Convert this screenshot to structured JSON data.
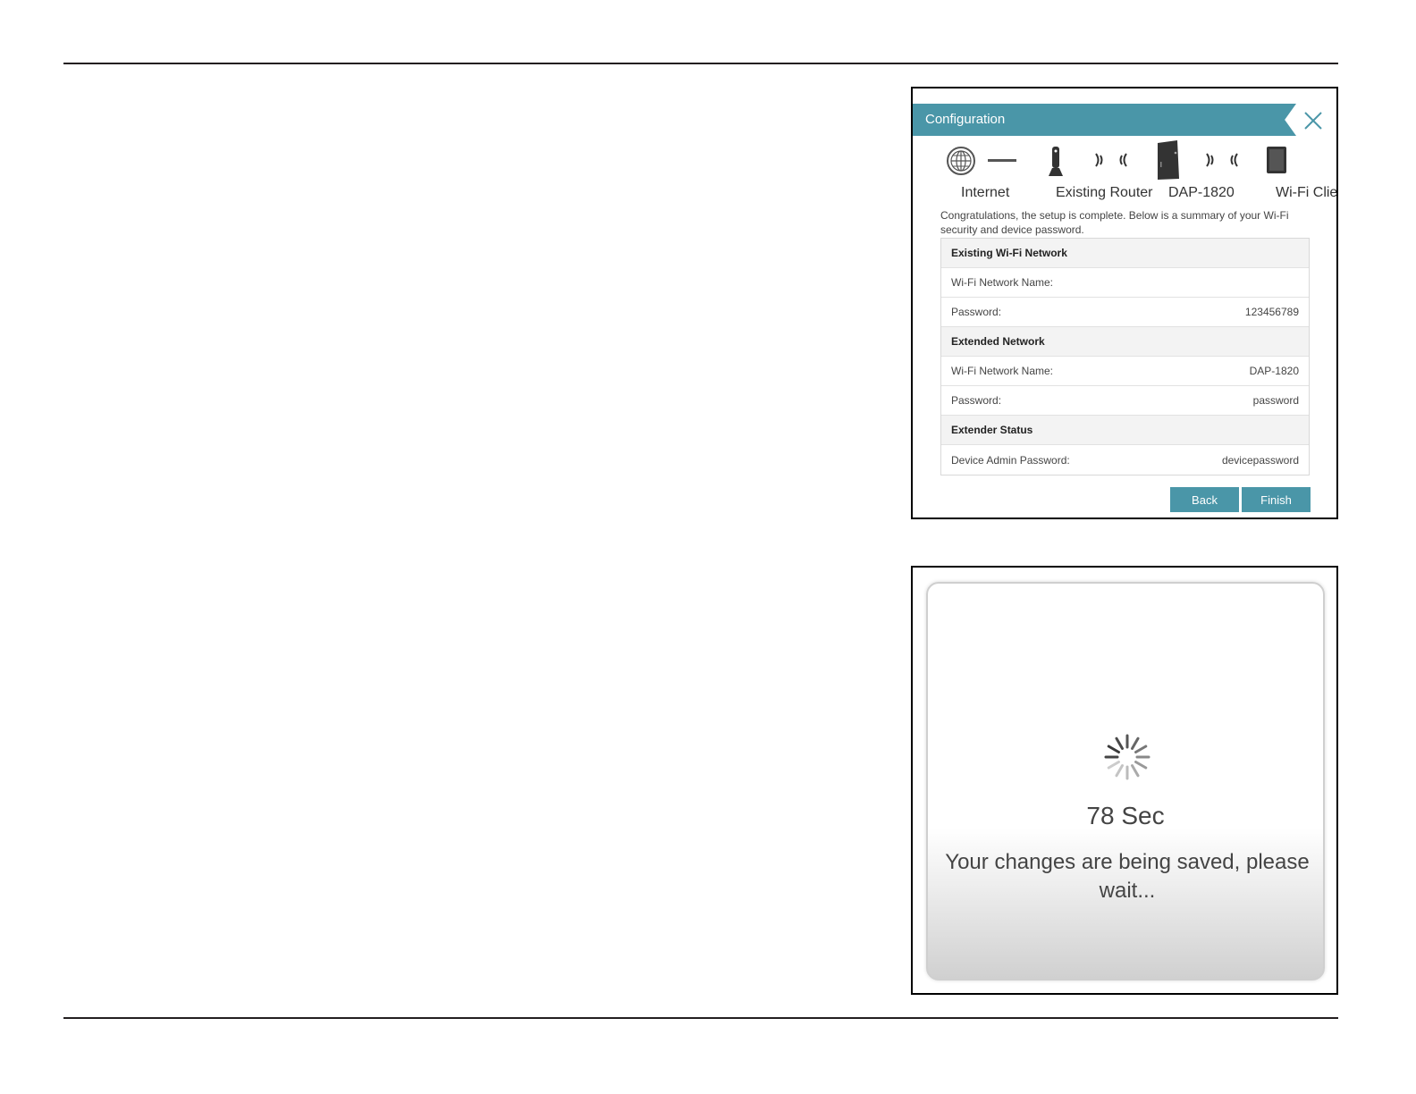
{
  "configuration": {
    "title": "Configuration",
    "topology": {
      "internet_label": "Internet",
      "router_label": "Existing Router",
      "extender_label": "DAP-1820",
      "client_label": "Wi-Fi Client"
    },
    "intro_text": "Congratulations, the setup is complete. Below is a summary of your Wi-Fi security and device password.",
    "sections": [
      {
        "heading": "Existing Wi-Fi Network",
        "rows": [
          {
            "label": "Wi-Fi Network Name:",
            "value": ""
          },
          {
            "label": "Password:",
            "value": "123456789"
          }
        ]
      },
      {
        "heading": "Extended Network",
        "rows": [
          {
            "label": "Wi-Fi Network Name:",
            "value": "DAP-1820"
          },
          {
            "label": "Password:",
            "value": "password"
          }
        ]
      },
      {
        "heading": "Extender Status",
        "rows": [
          {
            "label": "Device Admin Password:",
            "value": "devicepassword"
          }
        ]
      }
    ],
    "buttons": {
      "back": "Back",
      "finish": "Finish"
    },
    "accent_color": "#4a96a8"
  },
  "saving": {
    "countdown": "78 Sec",
    "message": "Your changes are being saved, please wait..."
  }
}
